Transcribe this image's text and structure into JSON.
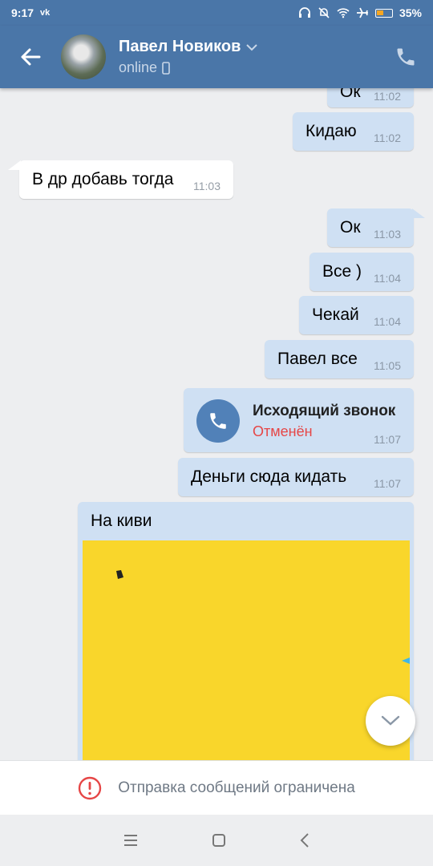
{
  "status_bar": {
    "time": "9:17",
    "app_badge": "vk",
    "battery": "35%"
  },
  "header": {
    "name": "Павел Новиков",
    "status": "online"
  },
  "messages": [
    {
      "text": "Ок",
      "time": "11:02",
      "direction": "out"
    },
    {
      "text": "Кидаю",
      "time": "11:02",
      "direction": "out"
    },
    {
      "text": "В др добавь тогда",
      "time": "11:03",
      "direction": "in"
    },
    {
      "text": "Ок",
      "time": "11:03",
      "direction": "out"
    },
    {
      "text": "Все )",
      "time": "11:04",
      "direction": "out"
    },
    {
      "text": "Чекай",
      "time": "11:04",
      "direction": "out"
    },
    {
      "text": "Павел все",
      "time": "11:05",
      "direction": "out"
    },
    {
      "text": "Деньги сюда кидать",
      "time": "11:07",
      "direction": "out"
    },
    {
      "text": "На киви",
      "time": "",
      "direction": "out"
    }
  ],
  "call": {
    "title": "Исходящий звонок",
    "status": "Отменён",
    "time": "11:07"
  },
  "restriction": {
    "label": "Отправка сообщений ограничена"
  },
  "colors": {
    "header": "#4a76a8",
    "outgoing_bubble": "#cfe0f3",
    "incoming_bubble": "#ffffff",
    "photo_yellow": "#f9d62b",
    "cancel_red": "#e64646"
  },
  "icons": [
    "back-arrow-icon",
    "chevron-down-icon",
    "mobile-icon",
    "phone-icon",
    "call-icon",
    "scroll-down-icon",
    "warning-icon",
    "menu-icon",
    "home-icon",
    "back-icon"
  ]
}
